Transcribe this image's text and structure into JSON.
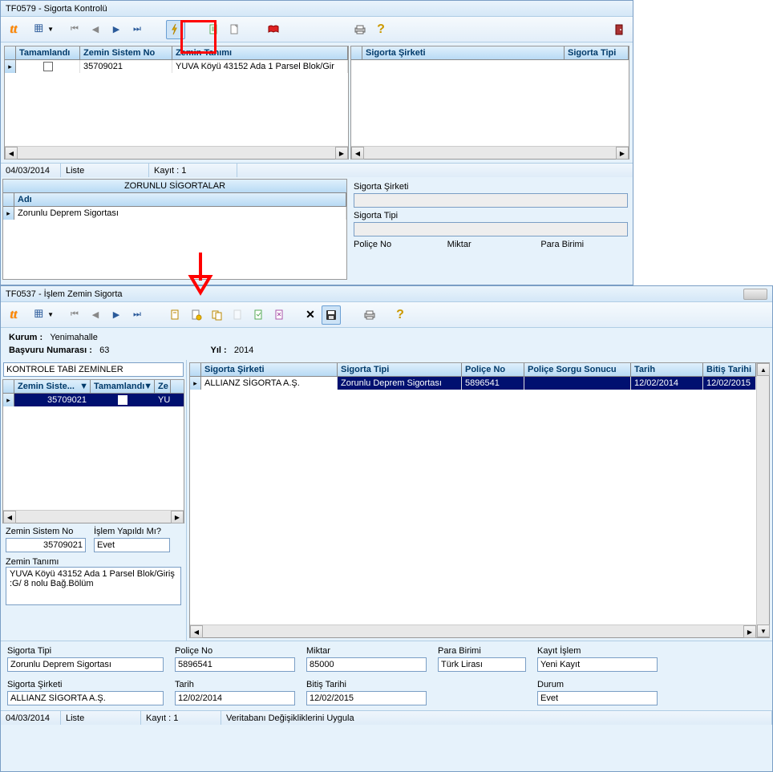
{
  "win1": {
    "title": "TF0579 - Sigorta Kontrolü",
    "grid1": {
      "headers": [
        "Tamamlandı",
        "Zemin Sistem No",
        "Zemin Tanımı",
        "Sigorta Şirketi",
        "Sigorta Tipi"
      ],
      "row": {
        "tamamlandi": false,
        "zemin_sistem_no": "35709021",
        "zemin_tanimi": "YUVA Köyü 43152 Ada 1 Parsel Blok/Gir"
      }
    },
    "status": {
      "date": "04/03/2014",
      "liste": "Liste",
      "kayit": "Kayıt : 1"
    },
    "section2_title": "ZORUNLU SİGORTALAR",
    "adi_header": "Adı",
    "adi_value": "Zorunlu Deprem Sigortası",
    "labels": {
      "sigorta_sirketi": "Sigorta Şirketi",
      "sigorta_tipi": "Sigorta Tipi",
      "police_no": "Poliçe No",
      "miktar": "Miktar",
      "para_birimi": "Para Birimi"
    }
  },
  "win2": {
    "title": "TF0537 - İşlem Zemin Sigorta",
    "header_info": {
      "kurum_label": "Kurum :",
      "kurum_value": "Yenimahalle",
      "basvuru_label": "Başvuru Numarası :",
      "basvuru_value": "63",
      "yil_label": "Yıl :",
      "yil_value": "2014"
    },
    "left_panel": {
      "title": "KONTROLE TABİ ZEMİNLER",
      "headers": [
        "Zemin Siste...",
        "Tamamlandı",
        "Ze"
      ],
      "row": {
        "zemin_no": "35709021",
        "tamamlandi": true,
        "z": "YU"
      },
      "zemin_sistem_no_label": "Zemin Sistem No",
      "zemin_sistem_no_value": "35709021",
      "islem_label": "İşlem Yapıldı Mı?",
      "islem_value": "Evet",
      "zemin_tanimi_label": "Zemin Tanımı",
      "zemin_tanimi_value": "YUVA Köyü 43152 Ada 1 Parsel Blok/Giriş\n:G/ 8 nolu Bağ.Bölüm"
    },
    "right_grid": {
      "headers": [
        "Sigorta Şirketi",
        "Sigorta Tipi",
        "Poliçe No",
        "Poliçe Sorgu Sonucu",
        "Tarih",
        "Bitiş Tarihi"
      ],
      "row": {
        "sirket": "ALLIANZ SİGORTA A.Ş.",
        "tip": "Zorunlu Deprem Sigortası",
        "police": "5896541",
        "sorgu": "",
        "tarih": "12/02/2014",
        "bitis": "12/02/2015"
      }
    },
    "bottom_fields": {
      "sigorta_tipi": {
        "label": "Sigorta Tipi",
        "value": "Zorunlu Deprem Sigortası"
      },
      "police_no": {
        "label": "Poliçe No",
        "value": "5896541"
      },
      "miktar": {
        "label": "Miktar",
        "value": "85000"
      },
      "para_birimi": {
        "label": "Para Birimi",
        "value": "Türk Lirası"
      },
      "kayit_islem": {
        "label": "Kayıt İşlem",
        "value": "Yeni Kayıt"
      },
      "sigorta_sirketi": {
        "label": "Sigorta Şirketi",
        "value": "ALLIANZ SİGORTA A.Ş."
      },
      "tarih": {
        "label": "Tarih",
        "value": "12/02/2014"
      },
      "bitis_tarihi": {
        "label": "Bitiş Tarihi",
        "value": "12/02/2015"
      },
      "durum": {
        "label": "Durum",
        "value": "Evet"
      }
    },
    "status": {
      "date": "04/03/2014",
      "liste": "Liste",
      "kayit": "Kayıt : 1",
      "msg": "Veritabanı Değişikliklerini Uygula"
    }
  }
}
